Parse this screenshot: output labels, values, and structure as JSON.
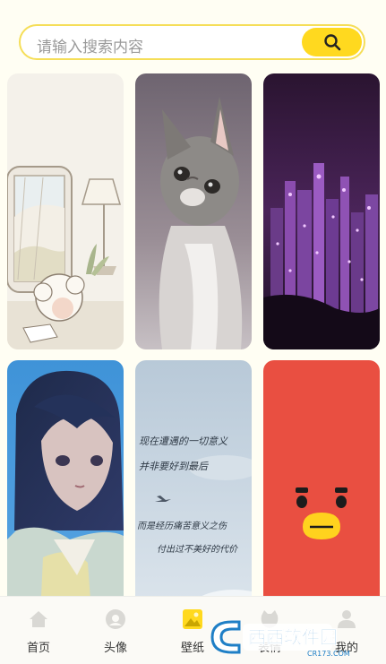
{
  "search": {
    "placeholder": "请输入搜索内容",
    "icon": "search-icon",
    "button_color": "#ffd91f",
    "border_color": "#f5de58"
  },
  "wallpapers": [
    {
      "subject": "illustration",
      "icon": "cartoon-girl-image"
    },
    {
      "subject": "kitten",
      "icon": "kitten-image"
    },
    {
      "subject": "city-night",
      "icon": "city-night-image"
    },
    {
      "subject": "anime-girl",
      "icon": "anime-girl-image"
    },
    {
      "subject": "sky-text",
      "text_lines": [
        "现在遭遇的一切意义",
        "并非要好到最后",
        "而是经历痛苦意义之伤",
        "付出过不美好的代价"
      ]
    },
    {
      "subject": "red-character",
      "icon": "red-cartoon-face-image"
    }
  ],
  "tabs": [
    {
      "label": "首页",
      "icon": "home-icon"
    },
    {
      "label": "头像",
      "icon": "avatar-icon"
    },
    {
      "label": "壁纸",
      "icon": "image-icon",
      "active": true
    },
    {
      "label": "表情",
      "icon": "emoji-icon"
    },
    {
      "label": "我的",
      "icon": "user-icon"
    }
  ],
  "watermark": {
    "text": "西西软件园",
    "url_text": "CR173.COM"
  },
  "colors": {
    "accent": "#ffd91f",
    "background": "#fffef3"
  }
}
